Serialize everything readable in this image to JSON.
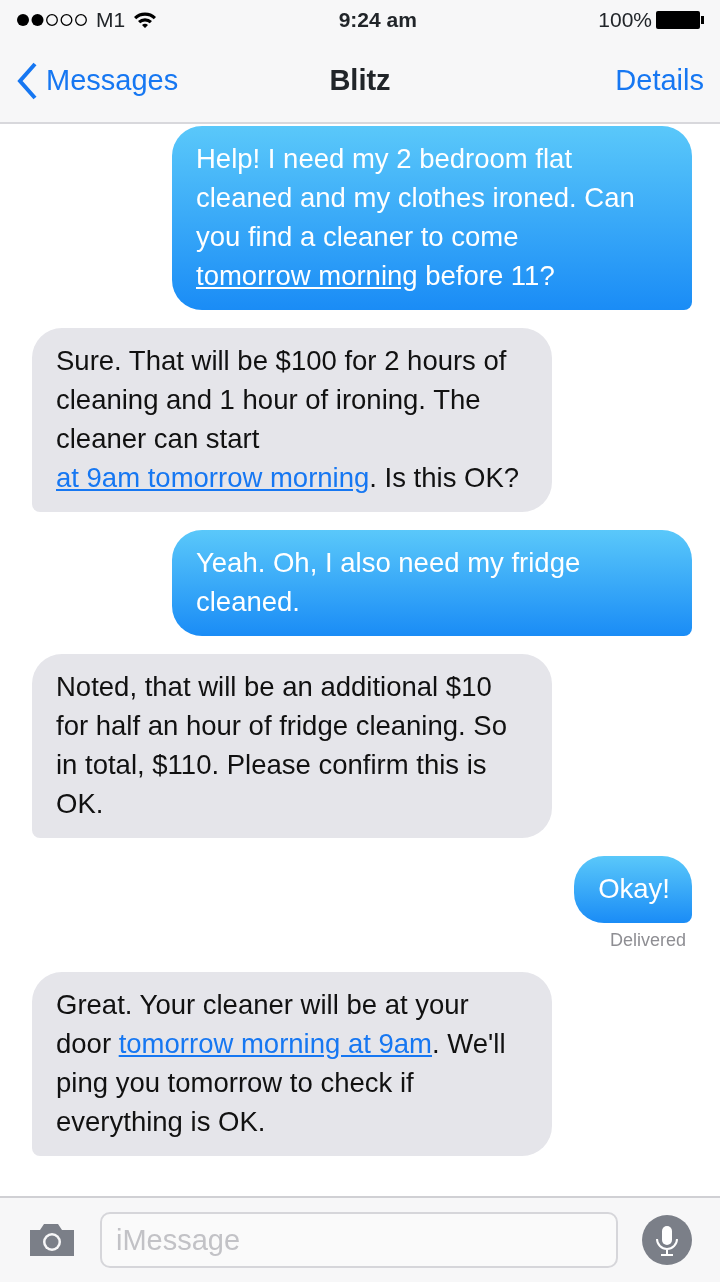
{
  "status_bar": {
    "carrier": "M1",
    "time": "9:24 am",
    "battery": "100%"
  },
  "nav": {
    "back": "Messages",
    "title": "Blitz",
    "action": "Details"
  },
  "messages": [
    {
      "kind": "outgoing",
      "parts": [
        {
          "kind": "text",
          "text": "Help! I need my 2 bedroom flat cleaned and my clothes ironed. Can you find a cleaner to come "
        },
        {
          "kind": "link",
          "text": "tomorrow morning"
        },
        {
          "kind": "text",
          "text": " before 11?"
        }
      ]
    },
    {
      "kind": "incoming",
      "parts": [
        {
          "kind": "text",
          "text": "Sure. That will be $100 for 2 hours of cleaning and 1 hour of ironing. The cleaner can start "
        },
        {
          "kind": "link",
          "text": "at 9am tomorrow morning"
        },
        {
          "kind": "text",
          "text": ". Is this OK?"
        }
      ]
    },
    {
      "kind": "outgoing",
      "parts": [
        {
          "kind": "text",
          "text": "Yeah. Oh, I also need my fridge cleaned."
        }
      ]
    },
    {
      "kind": "incoming",
      "parts": [
        {
          "kind": "text",
          "text": "Noted, that will be an additional $10 for half an hour of fridge cleaning. So in total, $110. Please confirm this is OK."
        }
      ]
    },
    {
      "kind": "outgoing",
      "parts": [
        {
          "kind": "text",
          "text": "Okay!"
        }
      ],
      "status": "Delivered"
    },
    {
      "kind": "incoming",
      "parts": [
        {
          "kind": "text",
          "text": "Great. Your cleaner will be at your door "
        },
        {
          "kind": "link",
          "text": "tomorrow morning at 9am"
        },
        {
          "kind": "text",
          "text": ". We'll ping you tomorrow to check if everything is OK."
        }
      ]
    }
  ],
  "composer": {
    "placeholder": "iMessage"
  }
}
